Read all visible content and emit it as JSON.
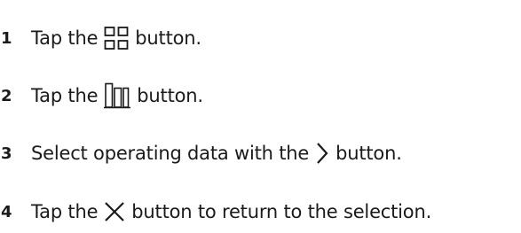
{
  "steps": [
    {
      "number": "1",
      "before": "Tap the",
      "icon": "grid-view-icon",
      "after": "button."
    },
    {
      "number": "2",
      "before": "Tap the",
      "icon": "bar-chart-icon",
      "after": "button."
    },
    {
      "number": "3",
      "before": "Select operating data with the",
      "icon": "chevron-right-icon",
      "after": "button."
    },
    {
      "number": "4",
      "before": "Tap the",
      "icon": "close-icon",
      "after": "button to return to the selection."
    }
  ]
}
